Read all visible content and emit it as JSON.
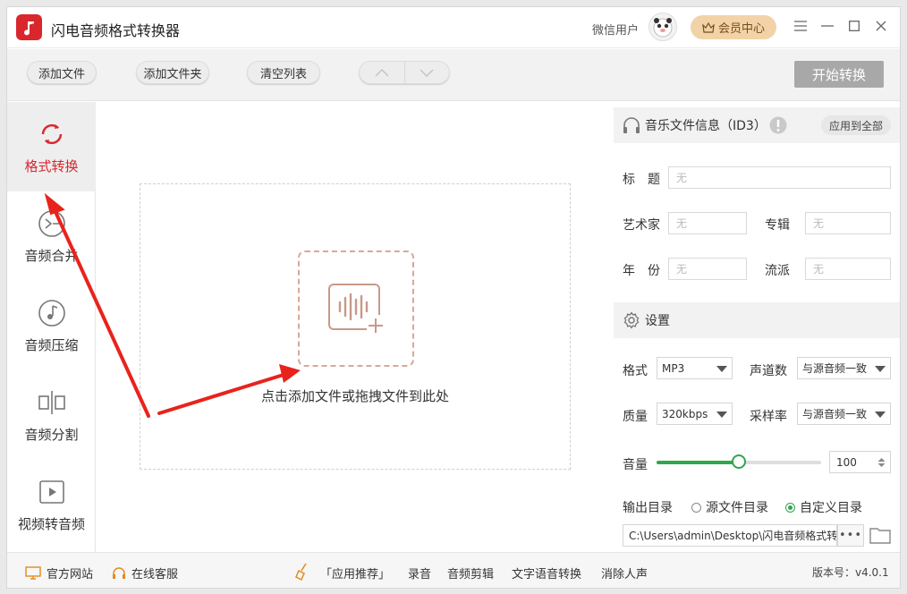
{
  "app": {
    "title": "闪电音频格式转换器"
  },
  "header": {
    "user_name": "微信用户",
    "vip_label": "会员中心"
  },
  "toolbar": {
    "add_file": "添加文件",
    "add_folder": "添加文件夹",
    "clear_list": "清空列表",
    "start": "开始转换"
  },
  "nav": {
    "items": [
      {
        "label": "格式转换",
        "icon": "refresh-icon",
        "active": true
      },
      {
        "label": "音频合并",
        "icon": "merge-icon"
      },
      {
        "label": "音频压缩",
        "icon": "music-note-icon"
      },
      {
        "label": "音频分割",
        "icon": "split-icon"
      },
      {
        "label": "视频转音频",
        "icon": "video-play-icon"
      }
    ]
  },
  "main": {
    "drop_hint": "点击添加文件或拖拽文件到此处"
  },
  "id3": {
    "title": "音乐文件信息（ID3）",
    "apply_all": "应用到全部",
    "fields": {
      "title_label": "标　题",
      "title_value": "无",
      "artist_label": "艺术家",
      "artist_value": "无",
      "album_label": "专辑",
      "album_value": "无",
      "year_label": "年　份",
      "year_value": "无",
      "genre_label": "流派",
      "genre_value": "无"
    }
  },
  "settings": {
    "title": "设置",
    "format_label": "格式",
    "format_value": "MP3",
    "channels_label": "声道数",
    "channels_value": "与源音频一致",
    "quality_label": "质量",
    "quality_value": "320kbps",
    "samplerate_label": "采样率",
    "samplerate_value": "与源音频一致",
    "volume_label": "音量",
    "volume_value": "100",
    "volume_fraction": 0.5,
    "output_label": "输出目录",
    "output_source": "源文件目录",
    "output_custom": "自定义目录",
    "output_path": "C:\\Users\\admin\\Desktop\\闪电音频格式转",
    "more_label": "•••"
  },
  "footer": {
    "website": "官方网站",
    "service": "在线客服",
    "recommend": "「应用推荐」",
    "record": "录音",
    "audio_edit": "音频剪辑",
    "tts": "文字语音转换",
    "vocal_remove": "消除人声",
    "version": "版本号：v4.0.1"
  },
  "colors": {
    "accent_red": "#d9272e",
    "green": "#2ea84a",
    "vip_gold": "#f2d3a8"
  }
}
